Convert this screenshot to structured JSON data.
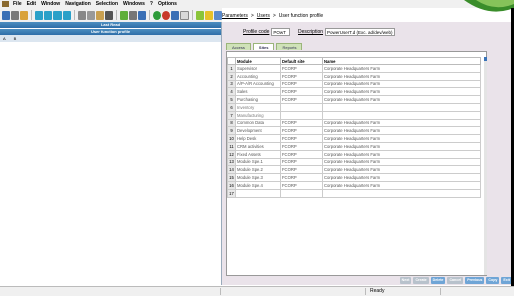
{
  "menu": [
    "File",
    "Edit",
    "Window",
    "Navigation",
    "Selection",
    "Windows",
    "?",
    "Options"
  ],
  "breadcrumb": [
    "Parameters",
    "Users",
    "User function profile"
  ],
  "left_panel": {
    "header1": "Last Read",
    "header2": "User function profile",
    "col_a": "A",
    "col_b": "B"
  },
  "form": {
    "profile_code_label": "Profile code",
    "profile_code_value": "POwT",
    "description_label": "Description",
    "description_value": "PowerUserT.d (Exc. ad/dev/web)"
  },
  "tabs": [
    "Access",
    "Sites",
    "Reports"
  ],
  "active_tab": "Sites",
  "table": {
    "columns": [
      "",
      "Module",
      "Default site",
      "Name"
    ],
    "rows": [
      [
        "1",
        "Supervisor",
        "FCORP",
        "Corporate Headquarters Farm"
      ],
      [
        "2",
        "Accounting",
        "FCORP",
        "Corporate Headquarters Farm"
      ],
      [
        "3",
        "A/P-A/R Accounting",
        "FCORP",
        "Corporate Headquarters Farm"
      ],
      [
        "4",
        "Sales",
        "FCORP",
        "Corporate Headquarters Farm"
      ],
      [
        "5",
        "Purchasing",
        "FCORP",
        "Corporate Headquarters Farm"
      ],
      [
        "6",
        "Inventory",
        "",
        ""
      ],
      [
        "7",
        "Manufacturing",
        "",
        ""
      ],
      [
        "8",
        "Common Data",
        "FCORP",
        "Corporate Headquarters Farm"
      ],
      [
        "9",
        "Development",
        "FCORP",
        "Corporate Headquarters Farm"
      ],
      [
        "10",
        "Help Desk",
        "FCORP",
        "Corporate Headquarters Farm"
      ],
      [
        "11",
        "CRM activities",
        "FCORP",
        "Corporate Headquarters Farm"
      ],
      [
        "12",
        "Fixed Assets",
        "FCORP",
        "Corporate Headquarters Farm"
      ],
      [
        "13",
        "Module Spe.1",
        "FCORP",
        "Corporate Headquarters Farm"
      ],
      [
        "14",
        "Module Spe.2",
        "FCORP",
        "Corporate Headquarters Farm"
      ],
      [
        "15",
        "Module Spe.3",
        "FCORP",
        "Corporate Headquarters Farm"
      ],
      [
        "16",
        "Module Spe.4",
        "FCORP",
        "Corporate Headquarters Farm"
      ],
      [
        "17",
        "",
        "",
        ""
      ]
    ]
  },
  "buttons": [
    {
      "label": "Next",
      "state": "disabled"
    },
    {
      "label": "Create",
      "state": "disabled"
    },
    {
      "label": "Delete",
      "state": "enabled"
    },
    {
      "label": "Cancel",
      "state": "disabled"
    },
    {
      "label": "Previous",
      "state": "enabled"
    },
    {
      "label": "Copy",
      "state": "enabled"
    },
    {
      "label": "Exit",
      "state": "enabled"
    }
  ],
  "status": "Ready",
  "colors": {
    "panel_bg": "#eae3ea",
    "tab_bg": "#cfe2b8",
    "header_blue": "#2f6ea8",
    "button_blue": "#6fa5d6"
  }
}
